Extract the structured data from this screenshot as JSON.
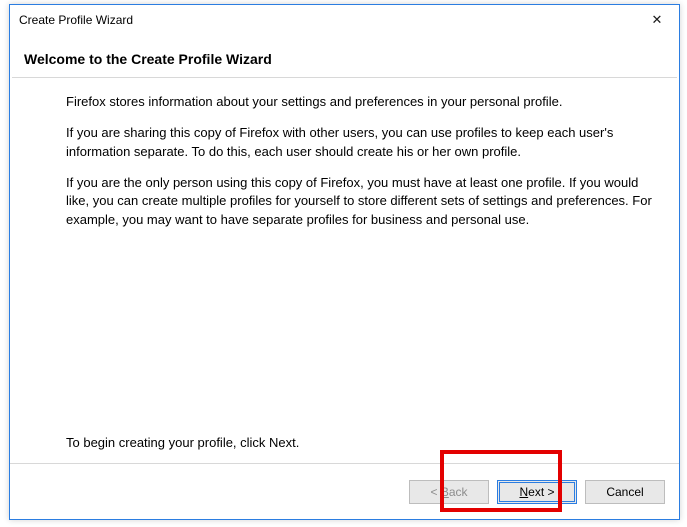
{
  "dialog": {
    "title": "Create Profile Wizard",
    "heading": "Welcome to the Create Profile Wizard",
    "close_glyph": "✕"
  },
  "body": {
    "p1": "Firefox stores information about your settings and preferences in your personal profile.",
    "p2": "If you are sharing this copy of Firefox with other users, you can use profiles to keep each user's information separate. To do this, each user should create his or her own profile.",
    "p3": "If you are the only person using this copy of Firefox, you must have at least one profile. If you would like, you can create multiple profiles for yourself to store different sets of settings and preferences. For example, you may want to have separate profiles for business and personal use.",
    "begin": "To begin creating your profile, click Next."
  },
  "buttons": {
    "back": "< Back",
    "next": "Next >",
    "cancel": "Cancel"
  }
}
